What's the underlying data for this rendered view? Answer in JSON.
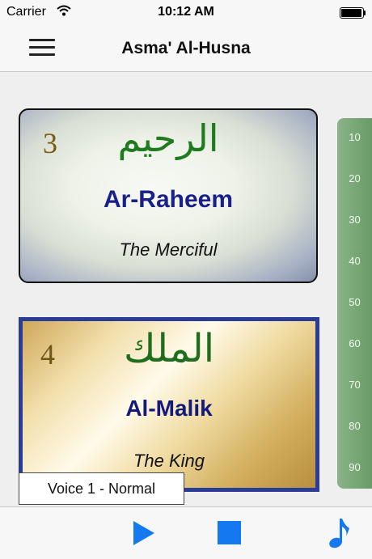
{
  "status_bar": {
    "carrier": "Carrier",
    "time": "10:12 AM",
    "wifi_icon": "wifi-icon",
    "battery_icon": "battery-full-icon"
  },
  "nav": {
    "menu_icon": "hamburger-menu-icon",
    "title": "Asma' Al-Husna"
  },
  "cards": [
    {
      "number": "3",
      "arabic": "الرحيم",
      "name": "Ar-Raheem",
      "meaning": "The Merciful"
    },
    {
      "number": "4",
      "arabic": "الملك",
      "name": "Al-Malik",
      "meaning": "The King"
    }
  ],
  "index": [
    "10",
    "20",
    "30",
    "40",
    "50",
    "60",
    "70",
    "80",
    "90"
  ],
  "voice": {
    "label": "Voice 1 - Normal"
  },
  "toolbar": {
    "play_icon": "play-icon",
    "stop_icon": "stop-icon",
    "music_icon": "music-note-icon"
  },
  "colors": {
    "accent": "#1479f0",
    "arabic_green": "#1e7b1e",
    "name_blue": "#1a1f8a",
    "index_green": "#79a877",
    "card_border_blue": "#2a3c96"
  }
}
